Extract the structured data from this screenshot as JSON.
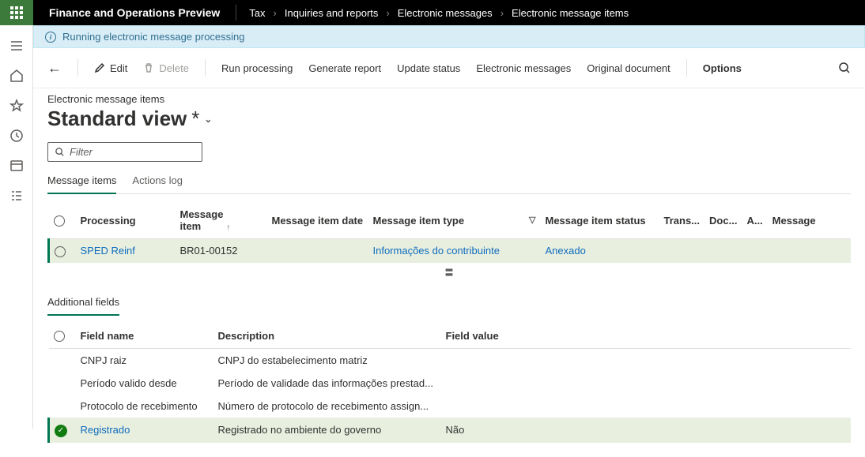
{
  "header": {
    "app_title": "Finance and Operations Preview",
    "breadcrumb": {
      "b1": "Tax",
      "b2": "Inquiries and reports",
      "b3": "Electronic messages",
      "b4": "Electronic message items"
    }
  },
  "notification": {
    "text": "Running electronic message processing"
  },
  "toolbar": {
    "edit": "Edit",
    "delete": "Delete",
    "run_processing": "Run processing",
    "generate_report": "Generate report",
    "update_status": "Update status",
    "electronic_messages": "Electronic messages",
    "original_document": "Original document",
    "options": "Options"
  },
  "page": {
    "subtitle": "Electronic message items",
    "title": "Standard view",
    "asterisk": "*"
  },
  "filter": {
    "placeholder": "Filter"
  },
  "tabs": {
    "t1": "Message items",
    "t2": "Actions log"
  },
  "grid1": {
    "headers": {
      "processing": "Processing",
      "message_item": "Message item",
      "message_item_date": "Message item date",
      "message_item_type": "Message item type",
      "message_item_status": "Message item status",
      "trans": "Trans...",
      "doc": "Doc...",
      "a": "A...",
      "message": "Message"
    },
    "row": {
      "processing": "SPED Reinf",
      "message_item": "BR01-00152",
      "message_item_date": "",
      "message_item_type": "Informações do contribuinte",
      "message_item_status": "Anexado"
    }
  },
  "section2": {
    "title": "Additional fields",
    "headers": {
      "field_name": "Field name",
      "description": "Description",
      "field_value": "Field value"
    },
    "rows": {
      "r1": {
        "name": "CNPJ raiz",
        "desc": "CNPJ do estabelecimento matriz",
        "value": ""
      },
      "r2": {
        "name": "Período valido desde",
        "desc": "Período de validade das informações prestad...",
        "value": ""
      },
      "r3": {
        "name": "Protocolo de recebimento",
        "desc": "Número de protocolo de recebimento assign...",
        "value": ""
      },
      "r4": {
        "name": "Registrado",
        "desc": "Registrado no ambiente do governo",
        "value": "Não"
      }
    }
  }
}
